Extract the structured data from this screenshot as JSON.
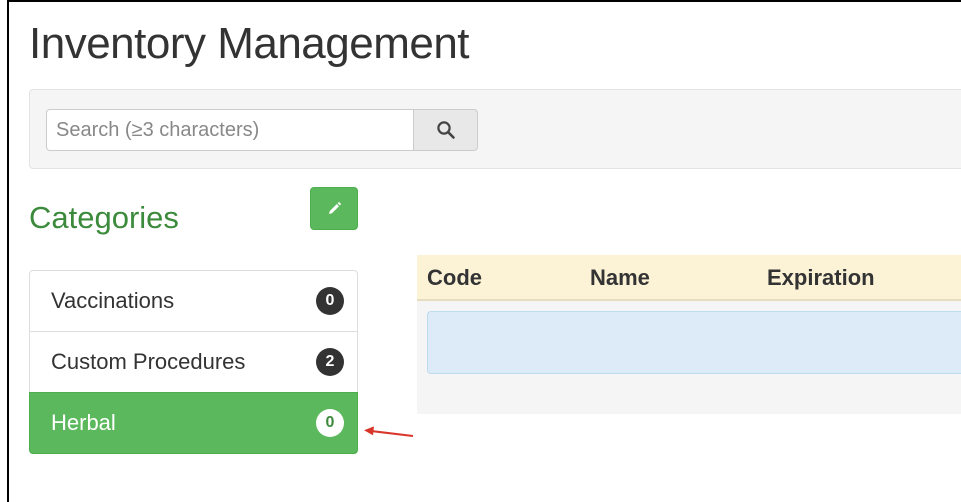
{
  "page": {
    "title": "Inventory Management"
  },
  "search": {
    "placeholder": "Search (≥3 characters)",
    "value": ""
  },
  "icons": {
    "search": "search-icon",
    "edit": "pencil-icon",
    "annotation": "arrow-left-icon"
  },
  "categories": {
    "title": "Categories",
    "items": [
      {
        "label": "Vaccinations",
        "count": "0",
        "active": false
      },
      {
        "label": "Custom Procedures",
        "count": "2",
        "active": false
      },
      {
        "label": "Herbal",
        "count": "0",
        "active": true
      }
    ]
  },
  "table": {
    "columns": [
      "Code",
      "Name",
      "Expiration"
    ]
  },
  "colors": {
    "accent_green": "#5cb85c",
    "title_green": "#3c8a3c",
    "table_header_bg": "#fcf3d7",
    "info_row_bg": "#dcebf7",
    "annotation_red": "#d9362b"
  }
}
